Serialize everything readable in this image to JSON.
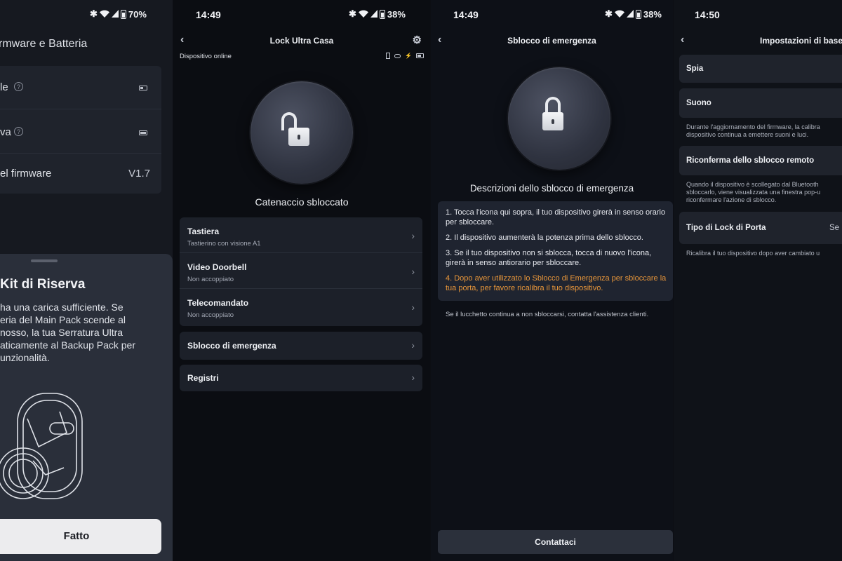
{
  "panel1": {
    "status": {
      "battery": "70%"
    },
    "header_title": "rmware e Batteria",
    "rows": [
      {
        "label": "le"
      },
      {
        "label": "va"
      },
      {
        "label": "el firmware",
        "value": "V1.7"
      }
    ],
    "sheet": {
      "title": "Kit di Riserva",
      "body": "ha una carica sufficiente. Se\neria del Main Pack scende al\nnosso, la tua Serratura Ultra\naticamente al Backup Pack per\nunzionalità.",
      "done_button": "Fatto"
    }
  },
  "panel2": {
    "status": {
      "time": "14:49",
      "battery": "38%"
    },
    "title": "Lock Ultra Casa",
    "device_status": "Dispositivo online",
    "lock_state": "Catenaccio sbloccato",
    "items": [
      {
        "title": "Tastiera",
        "subtitle": "Tastierino con visione A1"
      },
      {
        "title": "Video Doorbell",
        "subtitle": "Non accoppiato"
      },
      {
        "title": "Telecomandato",
        "subtitle": "Non accoppiato"
      }
    ],
    "emergency": "Sblocco di emergenza",
    "logs": "Registri"
  },
  "panel3": {
    "status": {
      "time": "14:49",
      "battery": "38%"
    },
    "title": "Sblocco di emergenza",
    "desc_title": "Descrizioni dello sblocco di emergenza",
    "steps": [
      "1. Tocca l'icona qui sopra, il tuo dispositivo girerà in senso orario per sbloccare.",
      "2. Il dispositivo aumenterà la potenza prima dello sblocco.",
      "3. Se il tuo dispositivo non si sblocca, tocca di nuovo l'icona, girerà in senso antiorario per sbloccare.",
      "4. Dopo aver utilizzato lo Sblocco di Emergenza per sbloccare la tua porta, per favore ricalibra il tuo dispositivo."
    ],
    "note": "Se il lucchetto continua a non sbloccarsi, contatta l'assistenza clienti.",
    "contact_button": "Contattaci"
  },
  "panel4": {
    "status": {
      "time": "14:50"
    },
    "title": "Impostazioni di base",
    "spia": "Spia",
    "suono": "Suono",
    "suono_note": "Durante l'aggiornamento del firmware, la calibra\ndispositivo continua a emettere suoni e luci.",
    "riconferma": "Riconferma dello sblocco remoto",
    "riconferma_note": "Quando il dispositivo è scollegato dal Bluetooth\nsbloccarlo, viene visualizzata una finestra pop-u\nriconfermare l'azione di sblocco.",
    "tipo": "Tipo di Lock di Porta",
    "tipo_value": "Se",
    "tipo_note": "Ricalibra il tuo dispositivo dopo aver cambiato u"
  },
  "colors": {
    "background": "#0c0e13",
    "card": "#1c2029",
    "highlight_text": "#e8963a",
    "button": "#2b303b",
    "done_button": "#ececee"
  }
}
